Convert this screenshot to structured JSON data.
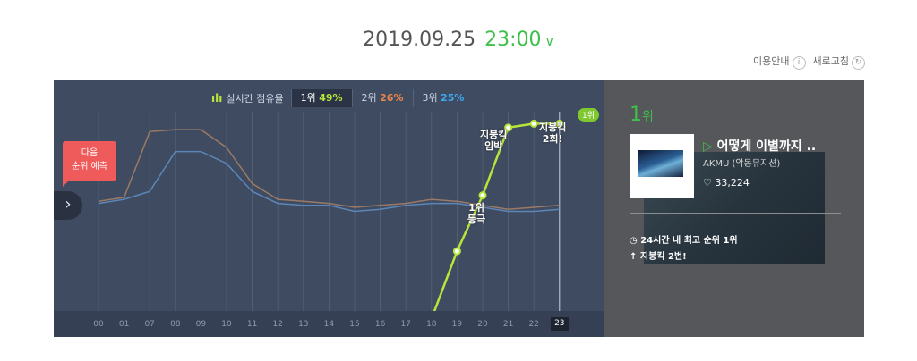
{
  "header": {
    "date": "2019.09.25",
    "time": "23:00",
    "chevron_icon": "chevron-down-icon",
    "guide_label": "이용안내",
    "info_icon": "info-icon",
    "refresh_label": "새로고침",
    "refresh_icon": "refresh-icon"
  },
  "legend": {
    "title": "실시간 점유율",
    "icon": "bar-chart-icon",
    "items": [
      {
        "rank": "1위",
        "value": "49%",
        "color": "#b6e63a"
      },
      {
        "rank": "2위",
        "value": "26%",
        "color": "#e6854c"
      },
      {
        "rank": "3위",
        "value": "25%",
        "color": "#3ea8ef"
      }
    ]
  },
  "prediction_badge": {
    "line1": "다음",
    "line2": "순위 예측"
  },
  "annotations": {
    "first_place_line1": "1위",
    "first_place_line2": "등극",
    "roof_break_line1": "지붕킥",
    "roof_break_line2": "임박",
    "roof_break2_line1": "지붕킥",
    "roof_break2_line2": "2회!",
    "rank_badge": "1위"
  },
  "chart_data": {
    "type": "line",
    "categories": [
      "00",
      "01",
      "07",
      "08",
      "09",
      "10",
      "11",
      "12",
      "13",
      "14",
      "15",
      "16",
      "17",
      "18",
      "19",
      "20",
      "21",
      "22",
      "23"
    ],
    "current_category": "23",
    "ylim": [
      0,
      50
    ],
    "series": [
      {
        "color": "#9a7a66",
        "values": [
          27.5,
          28.5,
          45,
          45.5,
          45.5,
          41,
          32,
          28,
          27.5,
          27,
          26,
          26.5,
          27,
          28,
          27.5,
          26.5,
          25.5,
          26,
          26.5
        ]
      },
      {
        "color": "#5c86b8",
        "values": [
          27,
          28,
          30,
          40,
          40,
          37,
          30,
          27,
          26.5,
          26.5,
          25,
          25.5,
          26.5,
          27,
          27,
          26,
          25,
          25,
          25.5
        ]
      },
      {
        "color": "#b6e63a",
        "values": [
          null,
          null,
          null,
          null,
          null,
          null,
          null,
          null,
          null,
          null,
          null,
          null,
          null,
          -2,
          15,
          29,
          46,
          47,
          47
        ]
      }
    ]
  },
  "side": {
    "rank_num": "1",
    "rank_suffix": "위",
    "song_title": "어떻게 이별까지 ..",
    "artist": "AKMU (악동뮤지션)",
    "likes": "33,224",
    "stat1": "24시간 내 최고 순위 1위",
    "stat2": "지붕킥 2번!",
    "clock_icon": "clock-icon",
    "up_icon": "arrow-up-icon",
    "heart_icon": "heart-icon",
    "play_icon": "play-icon"
  },
  "nav": {
    "next_icon": "chevron-right-icon"
  }
}
